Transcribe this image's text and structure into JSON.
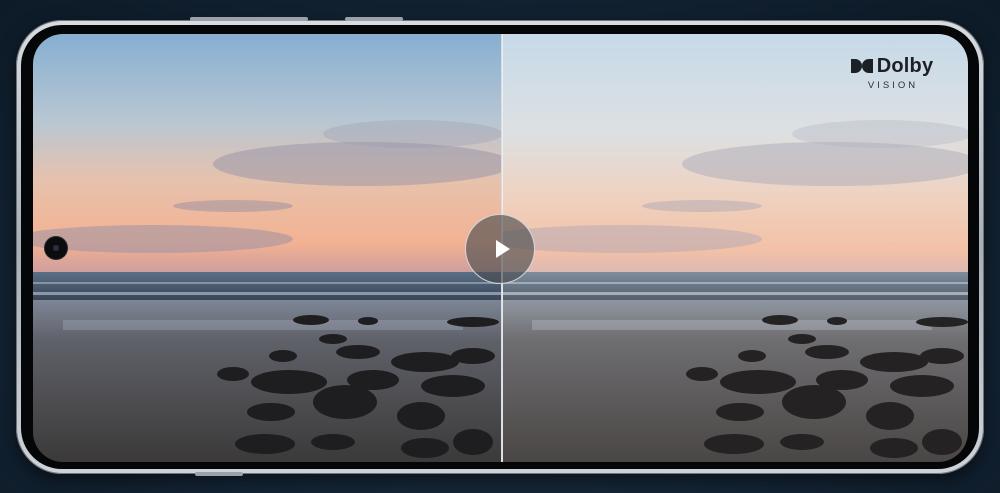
{
  "badge": {
    "brand": "Dolby",
    "subtitle": "VISION",
    "mark_icon": "dolby-double-d-icon"
  },
  "controls": {
    "play_icon": "play-icon"
  },
  "colors": {
    "frame_silver": "#c7cbd0",
    "background_navy": "#142536",
    "sky_left_top": "#8fb6d6",
    "sky_right_top": "#c9dcea",
    "horizon_glow": "#f2b79b",
    "sand_dark": "#3c3a3a"
  }
}
